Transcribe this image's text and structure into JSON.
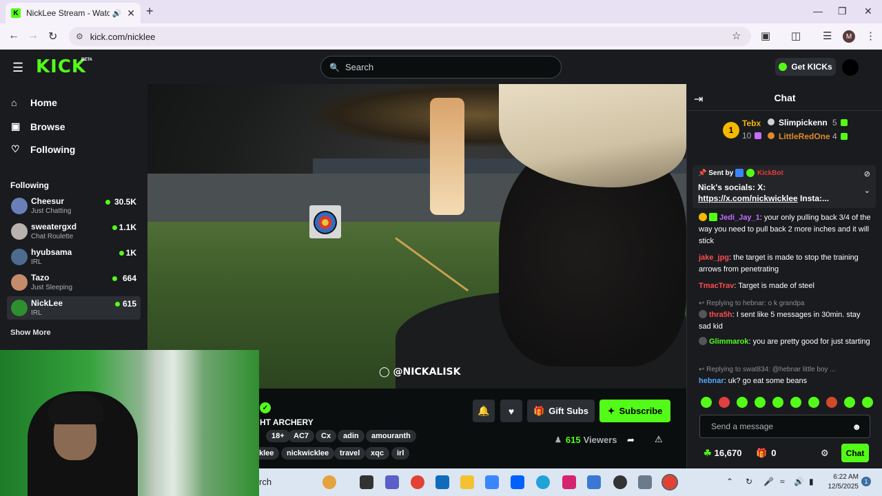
{
  "browser": {
    "tab_title": "NickLee Stream - Watch Liv",
    "tab_favicon": "K",
    "url": "kick.com/nicklee",
    "profile_initial": "M"
  },
  "kick": {
    "logo": "KICK",
    "logo_badge": "BETA",
    "search_placeholder": "Search",
    "get_kicks_label": "Get KICKs"
  },
  "sidebar": {
    "nav": [
      {
        "label": "Home",
        "icon": "home-icon"
      },
      {
        "label": "Browse",
        "icon": "browse-icon"
      },
      {
        "label": "Following",
        "icon": "heart-icon"
      }
    ],
    "following_header": "Following",
    "following": [
      {
        "name": "Cheesur",
        "category": "Just Chatting",
        "viewers": "30.5K",
        "avatar_color": "#6a7fb8"
      },
      {
        "name": "sweatergxd",
        "category": "Chat Roulette",
        "viewers": "1.1K",
        "avatar_color": "#b7b2ad"
      },
      {
        "name": "hyubsama",
        "category": "IRL",
        "viewers": "1K",
        "avatar_color": "#4d6b8f"
      },
      {
        "name": "Tazo",
        "category": "Just Sleeping",
        "viewers": "664",
        "avatar_color": "#c58b6a"
      },
      {
        "name": "NickLee",
        "category": "IRL",
        "viewers": "615",
        "avatar_color": "#2f8e2f"
      }
    ],
    "show_more": "Show More"
  },
  "stream": {
    "watermark": "@NICKALISK",
    "title_partial": "HT ARCHERY",
    "tags_row1": [
      "18+",
      "AC7",
      "Cx",
      "adin",
      "amouranth"
    ],
    "tags_row2": [
      "klee",
      "nickwicklee",
      "travel",
      "xqc",
      "irl"
    ],
    "gift_subs_label": "Gift Subs",
    "subscribe_label": "Subscribe",
    "viewers_count": "615",
    "viewers_label": "Viewers"
  },
  "chat": {
    "title": "Chat",
    "leaderboard": {
      "rank": "1",
      "first_name": "Tebx",
      "first_value": "10",
      "second_name": "Slimpickenn",
      "second_value": "5",
      "third_name": "LittleRedOne",
      "third_value": "4"
    },
    "pinned": {
      "sent_by": "Sent by",
      "bot_name": "KickBot",
      "message_prefix": "Nick's socials: X: ",
      "message_link": "https://x.com/nickwicklee",
      "message_suffix": " Insta:..."
    },
    "messages": [
      {
        "user": "Jedi_Jay_1",
        "color": "#c86bff",
        "text": ": your only pulling back 3/4 of the way you need to pull back 2 more inches and it will stick",
        "reply": ""
      },
      {
        "user": "jake_jpg",
        "color": "#ff4b4b",
        "text": ": the target is made to stop the training arrows from penetrating",
        "reply": ""
      },
      {
        "user": "TmacTrav",
        "color": "#ff4b4b",
        "text": ": Target is made of steel",
        "reply": ""
      },
      {
        "user": "thra5h",
        "color": "#ff4b4b",
        "text": ": I sent like 5 messages in 30min. stay sad kid",
        "reply": "Replying to hebnar: o k grandpa"
      },
      {
        "user": "Glimmarok",
        "color": "#53fc18",
        "text": ": you are pretty good for just starting",
        "reply": ""
      },
      {
        "user": "hebnar",
        "color": "#53a7ff",
        "text": ": uk? go eat some beans",
        "reply": "Replying to swat834: @hebnar little boy ..."
      }
    ],
    "send_placeholder": "Send a message",
    "kicks_balance": "16,670",
    "gift_count": "0",
    "chat_button": "Chat",
    "emote_colors": [
      "#53fc18",
      "#e04040",
      "#53fc18",
      "#53fc18",
      "#53fc18",
      "#53fc18",
      "#53fc18",
      "#d04a2a",
      "#53fc18",
      "#53fc18"
    ]
  },
  "taskbar": {
    "search_label": "rch",
    "time": "6:22 AM",
    "date": "12/5/2025",
    "notifications": "1"
  }
}
